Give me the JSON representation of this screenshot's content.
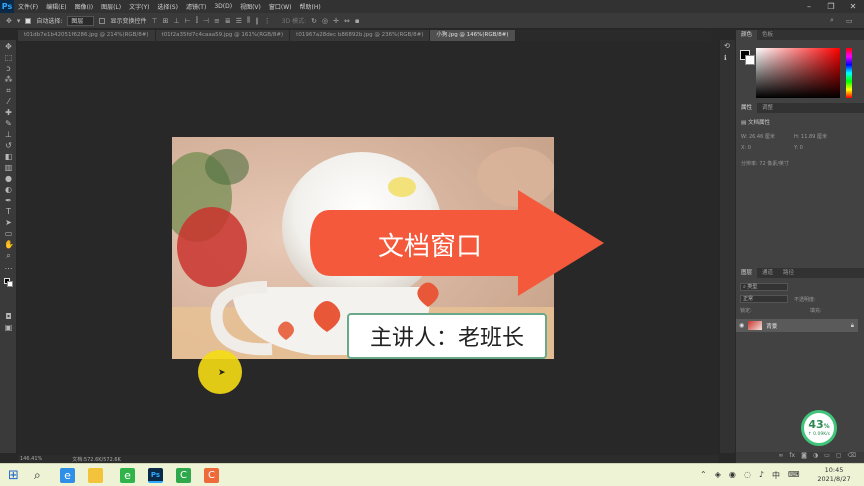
{
  "app": {
    "logo": "Ps"
  },
  "menu": [
    "文件(F)",
    "编辑(E)",
    "图像(I)",
    "图层(L)",
    "文字(Y)",
    "选择(S)",
    "滤镜(T)",
    "3D(D)",
    "视图(V)",
    "窗口(W)",
    "帮助(H)"
  ],
  "options": {
    "auto_select": "自动选择:",
    "auto_select_value": "图层",
    "show_transform": "显示变换控件",
    "mode3d": "3D 模式:"
  },
  "tabs": [
    {
      "label": "t01db7e1b42051f6286.jpg @ 214%(RGB/8#)",
      "active": false
    },
    {
      "label": "t01f2a35fd7c4caaa59.jpg @ 161%(RGB/8#)",
      "active": false
    },
    {
      "label": "t01967a28dec b86892b.jpg @ 236%(RGB/8#)",
      "active": false
    },
    {
      "label": "小狗.jpg @ 146%(RGB/8#)",
      "active": true
    }
  ],
  "overlay": {
    "banner": "文档窗口",
    "presenter": "主讲人：老班长"
  },
  "status": {
    "zoom": "146.41%",
    "doc": "文档:572.6K/572.6K"
  },
  "panels": {
    "color_tabs": [
      "颜色",
      "色板"
    ],
    "props_tabs": [
      "属性",
      "调整"
    ],
    "doc_props": "文档属性",
    "w_label": "W:",
    "w_value": "26.46 厘米",
    "h_label": "H:",
    "h_value": "11.89 厘米",
    "x_label": "X:",
    "x_value": "0",
    "y_label": "Y:",
    "y_value": "0",
    "resolution": "分辨率: 72 像素/英寸",
    "layer_tabs": [
      "图层",
      "通道",
      "路径"
    ],
    "kind": "类型",
    "blend": "正常",
    "opacity": "不透明度:",
    "lock": "锁定:",
    "fill": "填充:",
    "layer_name": "背景"
  },
  "network": {
    "percent": "43",
    "unit": "%",
    "speed": "↑ 0.09K/s"
  },
  "taskbar": {
    "time": "10:45",
    "date": "2021/8/27",
    "lang": "中"
  },
  "colors": {
    "banner": "#f4593c",
    "ps_blue": "#31a8ff",
    "taskbar": "#eef3d6"
  }
}
